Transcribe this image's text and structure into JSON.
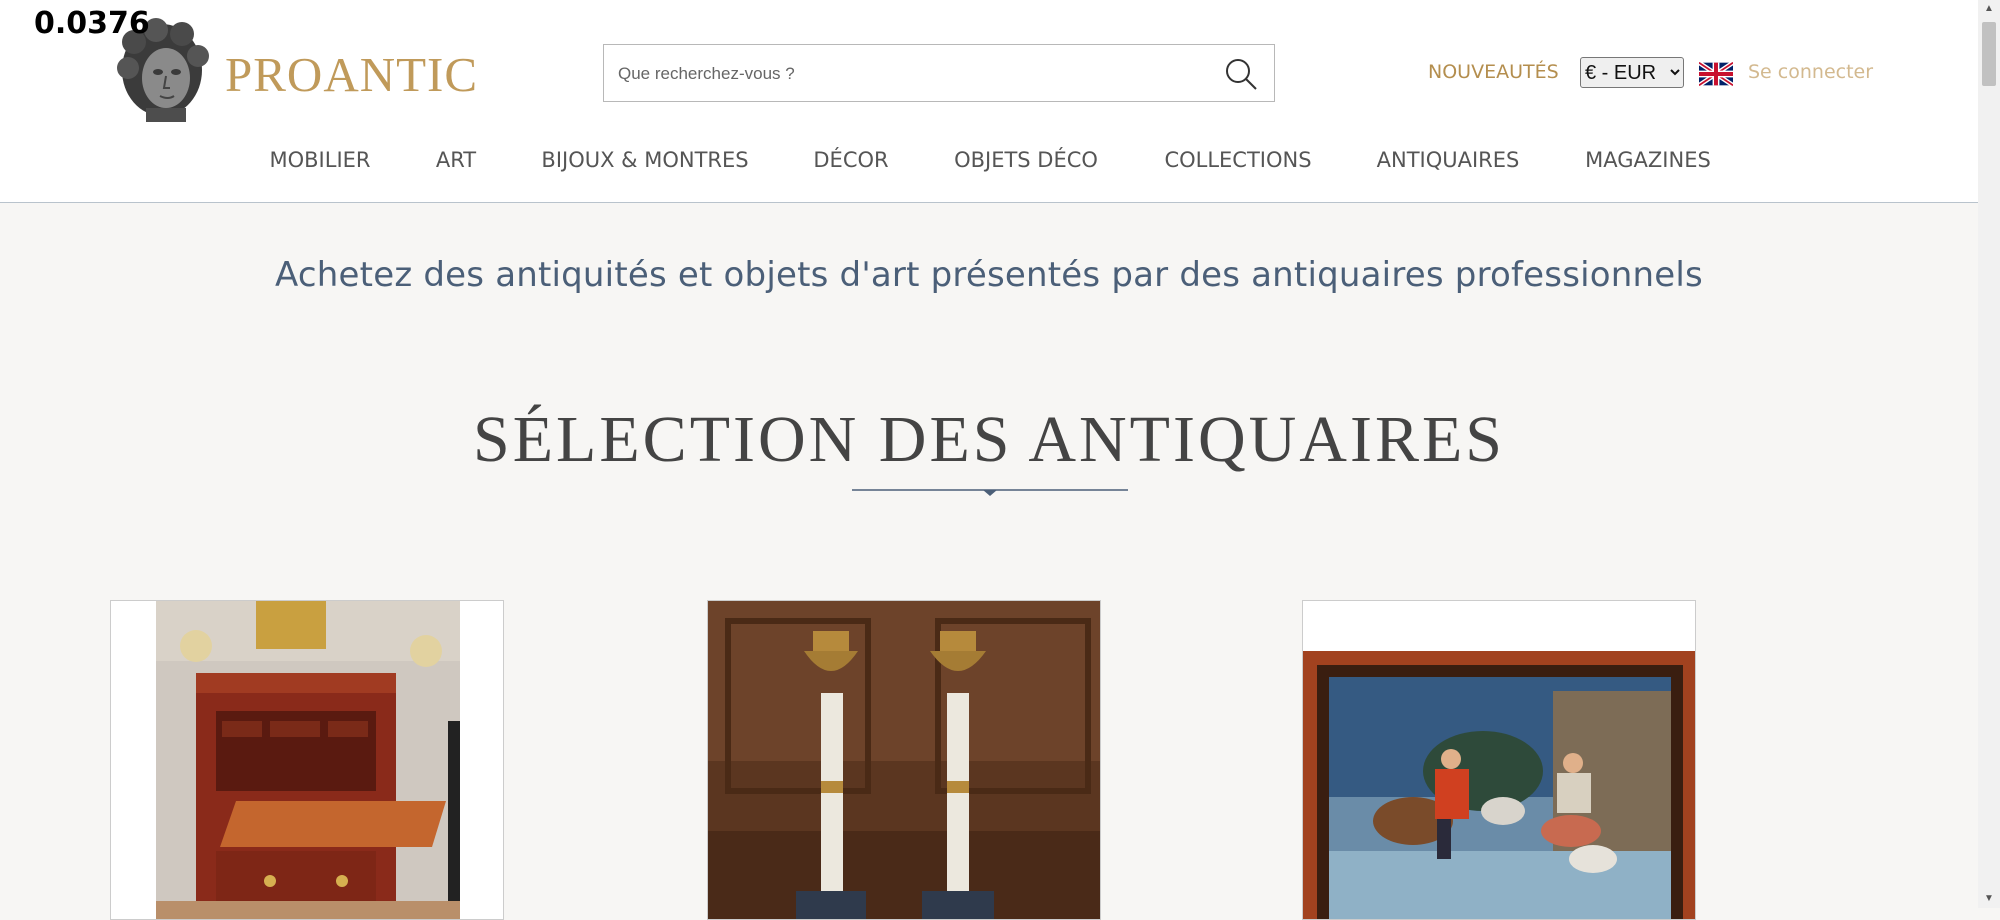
{
  "overlay_value": "0.0376",
  "header": {
    "brand": "PROANTIC",
    "search": {
      "placeholder": "Que recherchez-vous ?",
      "value": ""
    },
    "new_link": "NOUVEAUTÉS",
    "currency": {
      "selected": "€ - EUR",
      "options": [
        "€ - EUR"
      ]
    },
    "language_flag_icon": "uk-flag-icon",
    "login": "Se connecter"
  },
  "nav": {
    "items": [
      {
        "label": "MOBILIER"
      },
      {
        "label": "ART"
      },
      {
        "label": "BIJOUX & MONTRES"
      },
      {
        "label": "DÉCOR"
      },
      {
        "label": "OBJETS DÉCO"
      },
      {
        "label": "COLLECTIONS"
      },
      {
        "label": "ANTIQUAIRES"
      },
      {
        "label": "MAGAZINES"
      }
    ]
  },
  "main": {
    "tagline": "Achetez des antiquités et objets d'art présentés par des antiquaires professionnels",
    "section_title": "SÉLECTION DES ANTIQUAIRES",
    "cards": [
      {
        "image_icon": "secretary-desk-image"
      },
      {
        "image_icon": "candlesticks-image"
      },
      {
        "image_icon": "framed-painting-image"
      }
    ]
  },
  "colors": {
    "brand_gold": "#c09a5a",
    "nav_text": "#555555",
    "tagline_blue": "#4b5f78",
    "background": "#f7f6f4"
  }
}
